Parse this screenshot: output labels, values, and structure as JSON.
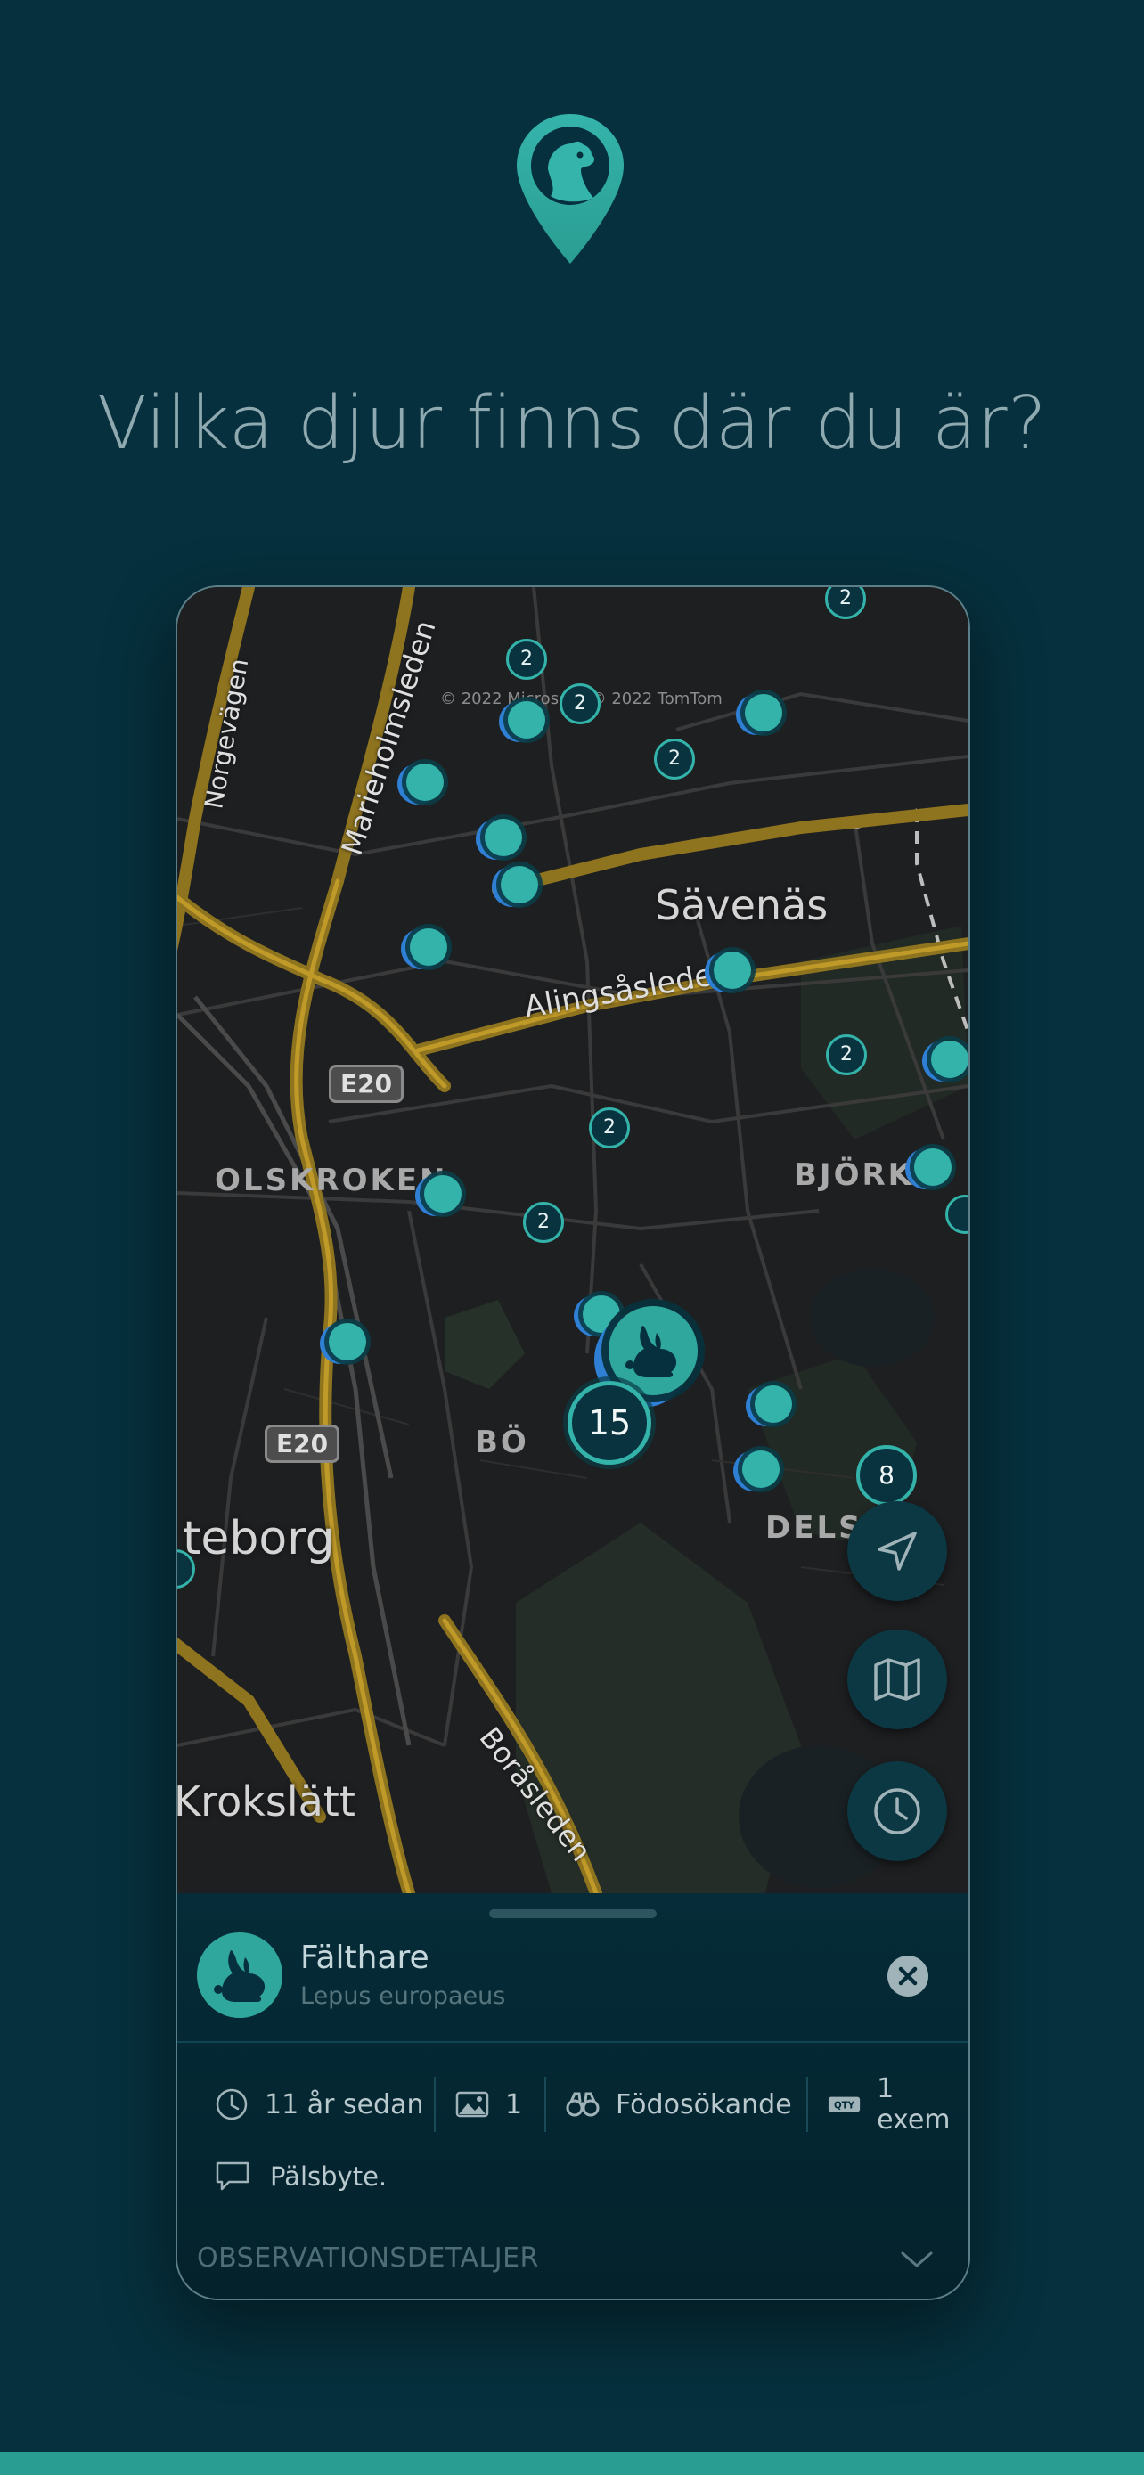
{
  "headline": "Vilka djur finns där du är?",
  "map": {
    "copyright": "© 2022 Microsoft, © 2022 TomTom",
    "labels": {
      "savenas": "Sävenäs",
      "olskroken": "OLSKROKEN",
      "bjorkekarr": "BJÖRKE",
      "bo": "BÖ",
      "delsjon": "DELS",
      "goteborg": "teborg",
      "krokslatt": "Krokslätt",
      "norgevagen": "Norgevägen",
      "marieholmsleden": "Marieholmsleden",
      "alingsasleden": "Alingsåsleden",
      "borasleden": "Boråsleden",
      "e20_a": "E20",
      "e20_b": "E20"
    },
    "cluster_counts": [
      "2",
      "2",
      "2",
      "2",
      "2",
      "2",
      "2",
      "2"
    ],
    "cluster_large": "15",
    "cluster_medium": "8"
  },
  "controls": {
    "locate": "navigation-arrow-icon",
    "map_layers": "map-icon",
    "history": "clock-icon"
  },
  "observation": {
    "species": "Fälthare",
    "latin": "Lepus europaeus",
    "time": "11 år sedan",
    "images": "1",
    "behavior": "Födosökande",
    "quantity": "1 exem",
    "comment": "Pälsbyte.",
    "details_label": "OBSERVATIONSDETALJER"
  },
  "colors": {
    "background": "#06303d",
    "accent": "#33b3a9",
    "sheet": "#052c38"
  }
}
